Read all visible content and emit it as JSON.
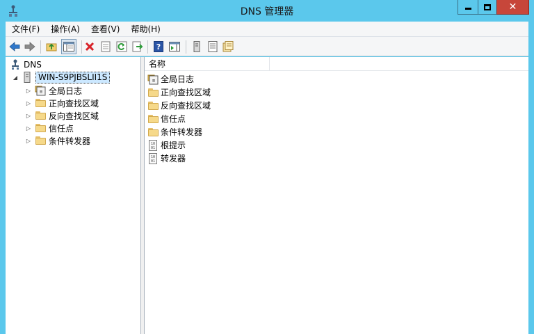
{
  "window": {
    "title": "DNS 管理器",
    "close_glyph": "✕"
  },
  "menu": {
    "items": [
      "文件(F)",
      "操作(A)",
      "查看(V)",
      "帮助(H)"
    ]
  },
  "toolbar": {
    "icons": [
      "back-arrow-icon",
      "forward-arrow-icon",
      "up-folder-icon",
      "show-hide-tree-icon",
      "delete-icon",
      "properties-icon",
      "refresh-icon",
      "export-list-icon",
      "help-icon",
      "action-pane-icon",
      "server-icon",
      "zone-list-icon",
      "new-zone-icon"
    ]
  },
  "tree": {
    "root": "DNS",
    "server": "WIN-S9PJBSLII1S",
    "children": [
      "全局日志",
      "正向查找区域",
      "反向查找区域",
      "信任点",
      "条件转发器"
    ]
  },
  "list": {
    "column_name": "名称",
    "items": [
      {
        "label": "全局日志",
        "icon": "log-icon"
      },
      {
        "label": "正向查找区域",
        "icon": "folder-icon"
      },
      {
        "label": "反向查找区域",
        "icon": "folder-icon"
      },
      {
        "label": "信任点",
        "icon": "folder-icon"
      },
      {
        "label": "条件转发器",
        "icon": "folder-icon"
      },
      {
        "label": "根提示",
        "icon": "record-icon"
      },
      {
        "label": "转发器",
        "icon": "record-icon"
      }
    ]
  },
  "colors": {
    "titlebar": "#5bc8ec",
    "close_button": "#c7463a",
    "selection": "#cce8ff"
  }
}
